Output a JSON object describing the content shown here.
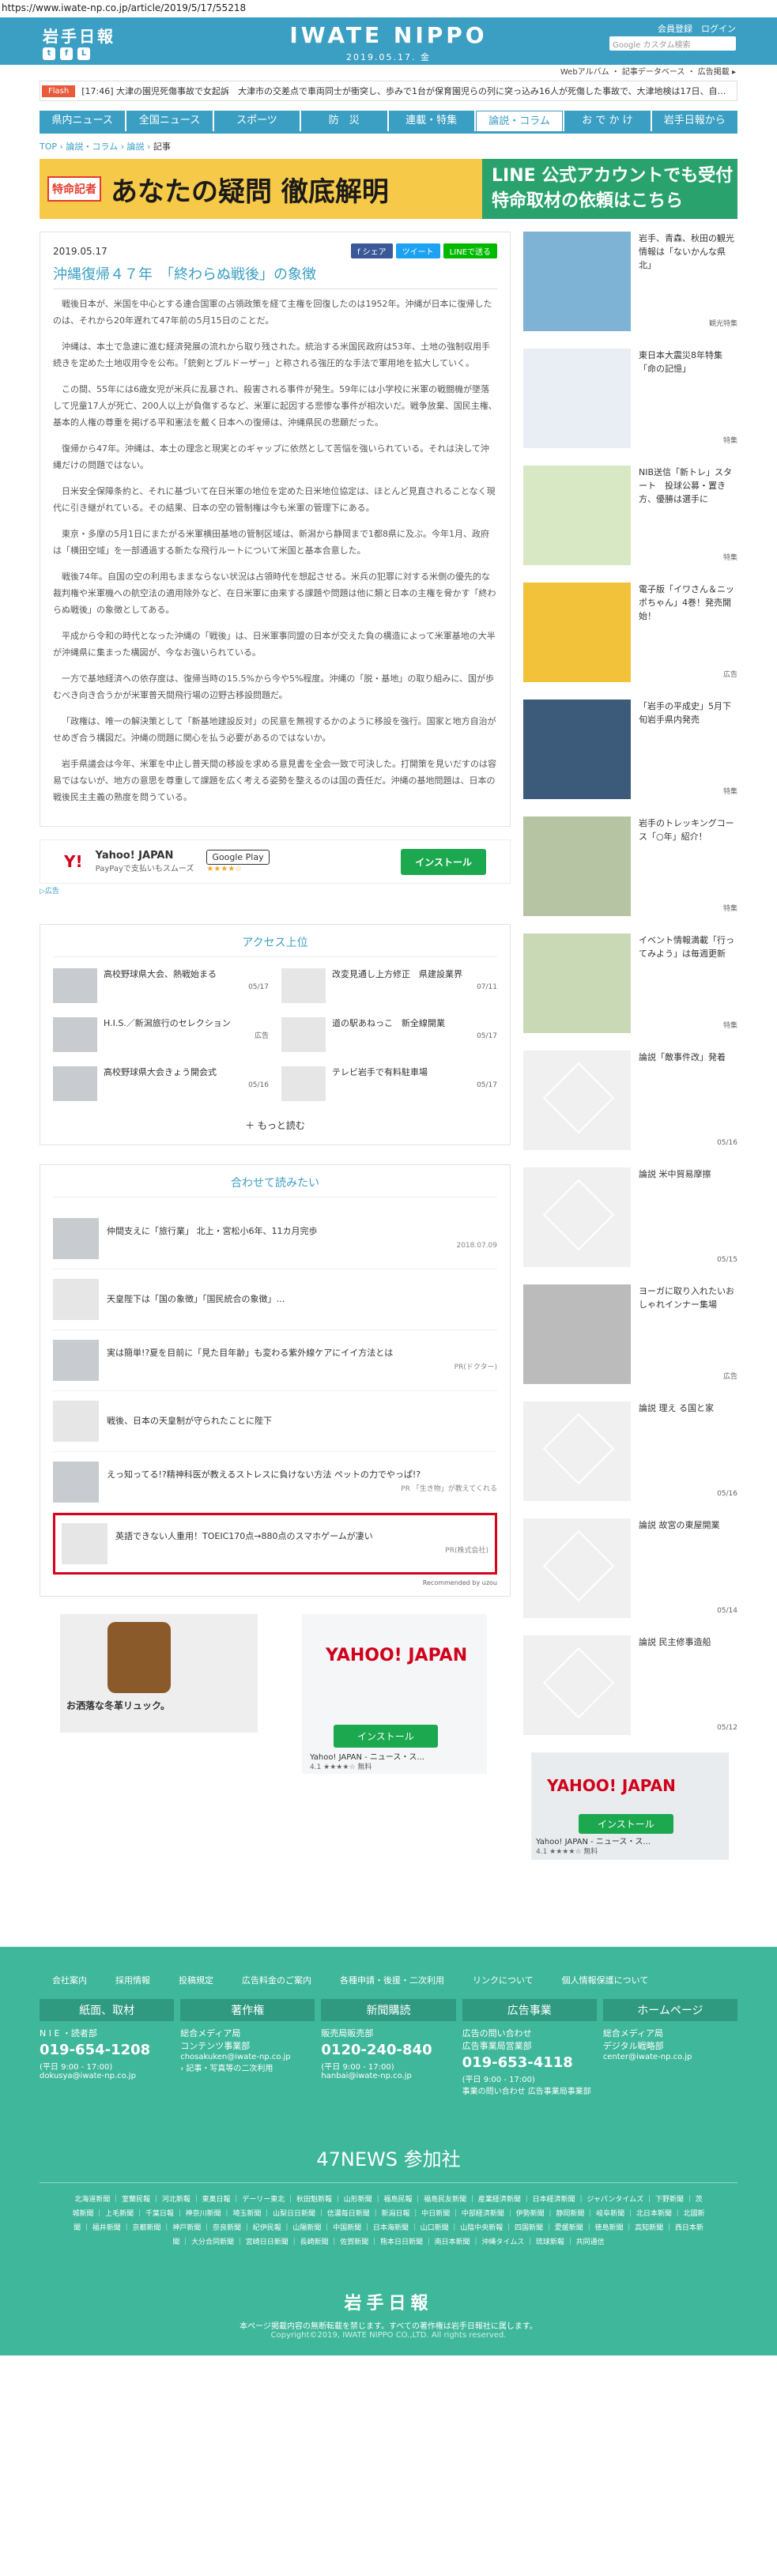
{
  "url": "https://www.iwate-np.co.jp/article/2019/5/17/55218",
  "header": {
    "logo": "岩手日報",
    "brand": "IWATE NIPPO",
    "date": "2019.05.17. 金",
    "member": "会員登録　ログイン",
    "search_placeholder": "Google カスタム検索",
    "sub_links": "Webアルバム ・ 記事データベース ・ 広告掲載 ▸"
  },
  "flash": {
    "tag": "Flash",
    "text": "[17:46] 大津の園児死傷事故で女起訴　大津市の交差点で車両同士が衝突し、歩みで1台が保育園児らの列に突っ込み16人が死傷した事故で、大津地検は17日、自…"
  },
  "nav": [
    "県内ニュース",
    "全国ニュース",
    "スポーツ",
    "防　災",
    "連載・特集",
    "論説・コラム",
    "お で か け",
    "岩手日報から"
  ],
  "breadcrumb": {
    "top": "TOP",
    "section": "論説・コラム",
    "sub": "論説",
    "current": "記事"
  },
  "banner": {
    "left_tag": "特命記者",
    "left_title": "あなたの疑問 徹底解明",
    "right_line1": "LINE 公式アカウントでも受付",
    "right_line2": "特命取材の依頼はこちら"
  },
  "article": {
    "date": "2019.05.17",
    "share_fb": "f シェア",
    "share_tw": "ツイート",
    "share_line": "LINEで送る",
    "title": "沖縄復帰４７年　「終わらぬ戦後」の象徴",
    "paragraphs": [
      "戦後日本が、米国を中心とする連合国軍の占領政策を経て主権を回復したのは1952年。沖縄が日本に復帰したのは、それから20年遅れて47年前の5月15日のことだ。",
      "沖縄は、本土で急速に進む経済発展の流れから取り残された。統治する米国民政府は53年、土地の強制収用手続きを定めた土地収用令を公布。「銃剣とブルドーザー」と称される強圧的な手法で軍用地を拡大していく。",
      "この間、55年には6歳女児が米兵に乱暴され、殺害される事件が発生。59年には小学校に米軍の戦闘機が墜落して児童17人が死亡、200人以上が負傷するなど、米軍に起因する悲惨な事件が相次いだ。戦争放棄、国民主権、基本的人権の尊重を掲げる平和憲法を戴く日本への復帰は、沖縄県民の悲願だった。",
      "復帰から47年。沖縄は、本土の理念と現実とのギャップに依然として苦悩を強いられている。それは決して沖縄だけの問題ではない。",
      "日米安全保障条約と、それに基づいて在日米軍の地位を定めた日米地位協定は、ほとんど見直されることなく現代に引き継がれている。その結果、日本の空の管制権は今も米軍の管理下にある。",
      "東京・多摩の5月1日にまたがる米軍横田基地の管制区域は、新潟から静岡まで1都8県に及ぶ。今年1月、政府は「横田空域」を一部通過する新たな飛行ルートについて米国と基本合意した。",
      "戦後74年。自国の空の利用もままならない状況は占領時代を想起させる。米兵の犯罪に対する米側の優先的な裁判権や米軍機への航空法の適用除外など、在日米軍に由来する課題や問題は他に類と日本の主権を脅かす「終わらぬ戦後」の象徴としてある。",
      "平成から令和の時代となった沖縄の「戦後」は、日米軍事同盟の日本が交えた負の構造によって米軍基地の大半が沖縄県に集まった構図が、今なお強いられている。",
      "一方で基地経済への依存度は、復帰当時の15.5%から今や5%程度。沖縄の「脱・基地」の取り組みに、国が歩むべき向き合うかが米軍普天間飛行場の辺野古移設問題だ。",
      "「政権は、唯一の解決策として「新基地建設反対」の民意を無視するかのように移設を強行。国家と地方自治がせめぎ合う構図だ。沖縄の問題に関心を払う必要があるのではないか。",
      "岩手県議会は今年、米軍を中止し普天間の移設を求める意見書を全会一致で可決した。打開策を見いだすのは容易ではないが、地方の意思を尊重して課題を広く考える姿勢を整えるのは国の責任だ。沖縄の基地問題は、日本の戦後民主主義の熟度を問うている。"
    ]
  },
  "ad_yahoo": {
    "logo": "Y!",
    "title": "Yahoo! JAPAN",
    "sub": "PayPayで支払いもスムーズ",
    "store": "Google Play",
    "rating": "★★★★☆",
    "button": "インストール",
    "note": "▷広告"
  },
  "ranking": {
    "title": "アクセス上位",
    "items": [
      {
        "text": "高校野球県大会、熱戦始まる",
        "date": "05/17"
      },
      {
        "text": "改変見通し上方修正　県建設業界",
        "date": "07/11"
      },
      {
        "text": "H.I.S.／新潟旅行のセレクション",
        "date": "広告"
      },
      {
        "text": "道の駅あねっこ　新全線開業",
        "date": "05/17"
      },
      {
        "text": "高校野球県大会きょう開会式",
        "date": "05/16"
      },
      {
        "text": "テレビ岩手で有料駐車場",
        "date": "05/17"
      }
    ],
    "more": "もっと読む"
  },
  "related": {
    "title": "合わせて読みたい",
    "items": [
      {
        "text": "仲間支えに「旅行業」 北上・宮松小6年、11カ月完歩",
        "src": "2018.07.09"
      },
      {
        "text": "天皇陛下は「国の象徴」「国民統合の象徴」…",
        "src": ""
      },
      {
        "text": "実は簡単!?夏を目前に「見た目年齢」も変わる紫外線ケアにイイ方法とは",
        "src": "PR(ドクター)"
      },
      {
        "text": "戦後、日本の天皇制が守られたことに陛下",
        "src": ""
      },
      {
        "text": "えっ知ってる!?精神科医が教えるストレスに負けない方法 ペットの力でやっぱ!?",
        "src": "PR 「生き物」が教えてくれる"
      },
      {
        "text": "英語できない人重用！TOEIC170点→880点のスマホゲームが凄い",
        "src": "PR(株式会社)"
      }
    ],
    "recommended": "Recommended by uzou"
  },
  "sidebar": [
    {
      "text": "岩手、青森、秋田の観光情報は「ないかんな県北」",
      "tag": "観光特集"
    },
    {
      "text": "東日本大震災8年特集「命の記憶」",
      "tag": "特集"
    },
    {
      "text": "NIB送信「新トレ」スタート　投球公募・置き方、優勝は選手に",
      "tag": "特集"
    },
    {
      "text": "電子版「イワさん＆ニッポちゃん」4巻！発売開始！",
      "tag": "広告"
    },
    {
      "text": "「岩手の平成史」5月下旬岩手県内発売",
      "tag": "特集"
    },
    {
      "text": "岩手のトレッキングコース「○年」紹介！",
      "tag": "特集"
    },
    {
      "text": "イベント情報満載「行ってみよう」は毎週更新",
      "tag": "特集"
    },
    {
      "text": "論説「敵事件改」発着",
      "tag": "05/16"
    },
    {
      "text": "論説 米中貿易摩擦",
      "tag": "05/15"
    },
    {
      "text": "ヨーガに取り入れたいおしゃれインナー集場",
      "tag": "広告"
    },
    {
      "text": "論説 理え る国と家",
      "tag": "05/16"
    },
    {
      "text": "論説 故宮の東屋開業",
      "tag": "05/14"
    },
    {
      "text": "論説 民主修事造船",
      "tag": "05/12"
    }
  ],
  "side_ad": {
    "logo": "YAHOO! JAPAN",
    "button": "インストール",
    "desc": "Yahoo! JAPAN - ニュース・ス...",
    "rating": "4.1 ★★★★☆ 無料"
  },
  "bottom_ads": {
    "a1_text": "お洒落な冬革リュック。",
    "a2_logo": "YAHOO! JAPAN",
    "a2_button": "インストール",
    "a2_desc": "Yahoo! JAPAN - ニュース・ス...",
    "a2_rating": "4.1 ★★★★☆ 無料"
  },
  "footer": {
    "links": [
      "会社案内",
      "採用情報",
      "投稿規定",
      "広告料金のご案内",
      "各種申請・後援・二次利用",
      "リンクについて",
      "個人情報保護について"
    ],
    "cols": [
      {
        "h": "紙面、取材",
        "l1": "N I E ・読者部",
        "p": "019-654-1208",
        "s": "(平日 9:00 - 17:00)",
        "m": "dokusya@iwate-np.co.jp"
      },
      {
        "h": "著作権",
        "l1": "総合メディア局\nコンテンツ事業部",
        "p": "",
        "s": "chosakuken@iwate-np.co.jp",
        "m": "› 記事・写真等の二次利用"
      },
      {
        "h": "新聞購読",
        "l1": "販売局販売部",
        "p": "0120-240-840",
        "s": "(平日 9:00 - 17:00)",
        "m": "hanbai@iwate-np.co.jp"
      },
      {
        "h": "広告事業",
        "l1": "広告の問い合わせ\n広告事業局営業部",
        "p": "019-653-4118",
        "s": "(平日 9:00 - 17:00)",
        "m": "事業の問い合わせ 広告事業局事業部"
      },
      {
        "h": "ホームページ",
        "l1": "総合メディア局\nデジタル戦略部",
        "p": "",
        "s": "center@iwate-np.co.jp",
        "m": ""
      }
    ],
    "n47": "47NEWS 参加社",
    "papers": "北海道新聞 ｜ 室蘭民報 ｜ 河北新報 ｜ 東奥日報 ｜ デーリー東北 ｜ 秋田魁新報 ｜ 山形新聞 ｜ 福島民報 ｜ 福島民友新聞 ｜ 産業経済新聞 ｜ 日本経済新聞 ｜ ジャパンタイムズ ｜ 下野新聞 ｜ 茨城新聞 ｜ 上毛新聞 ｜ 千葉日報 ｜ 神奈川新聞 ｜ 埼玉新聞 ｜ 山梨日日新聞 ｜ 信濃毎日新聞 ｜ 新潟日報 ｜ 中日新聞 ｜ 中部経済新聞 ｜ 伊勢新聞 ｜ 静岡新聞 ｜ 岐阜新聞 ｜ 北日本新聞 ｜ 北國新聞 ｜ 福井新聞 ｜ 京都新聞 ｜ 神戸新聞 ｜ 奈良新聞 ｜ 紀伊民報 ｜ 山陽新聞 ｜ 中国新聞 ｜ 日本海新聞 ｜ 山口新聞 ｜ 山陰中央新報 ｜ 四国新聞 ｜ 愛媛新聞 ｜ 徳島新聞 ｜ 高知新聞 ｜ 西日本新聞 ｜ 大分合同新聞 ｜ 宮崎日日新聞 ｜ 長崎新聞 ｜ 佐賀新聞 ｜ 熊本日日新聞 ｜ 南日本新聞 ｜ 沖縄タイムス ｜ 琉球新報 ｜ 共同通信",
    "logo": "岩手日報",
    "copy": "本ページ掲載内容の無断転載を禁じます。すべての著作権は岩手日報社に属します。",
    "copy2": "Copyright©2019, IWATE NIPPO CO.,LTD. All rights reserved."
  }
}
